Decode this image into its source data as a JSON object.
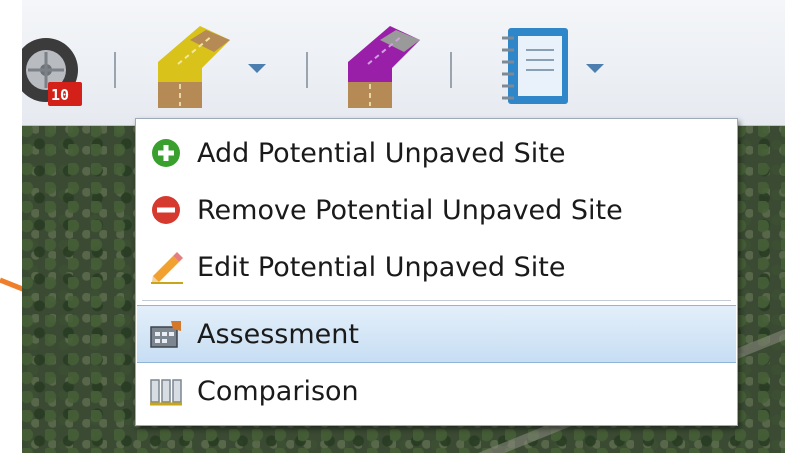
{
  "toolbar": {
    "tools": [
      {
        "name": "tire-speed-tool",
        "badge": "10"
      },
      {
        "name": "yellow-road-segment-tool"
      },
      {
        "name": "purple-road-segment-tool"
      },
      {
        "name": "notebook-tool"
      }
    ]
  },
  "menu": {
    "items": [
      {
        "label": "Add Potential Unpaved Site",
        "icon": "add-icon"
      },
      {
        "label": "Remove Potential Unpaved Site",
        "icon": "remove-icon"
      },
      {
        "label": "Edit Potential Unpaved Site",
        "icon": "pencil-icon"
      },
      {
        "label": "Assessment",
        "icon": "assessment-icon",
        "highlighted": true
      },
      {
        "label": "Comparison",
        "icon": "comparison-icon"
      }
    ]
  },
  "colors": {
    "annotation_arrow": "#f07f2c",
    "menu_highlight": "#c7def3",
    "add": "#3aa02d",
    "remove": "#d63a2e"
  }
}
